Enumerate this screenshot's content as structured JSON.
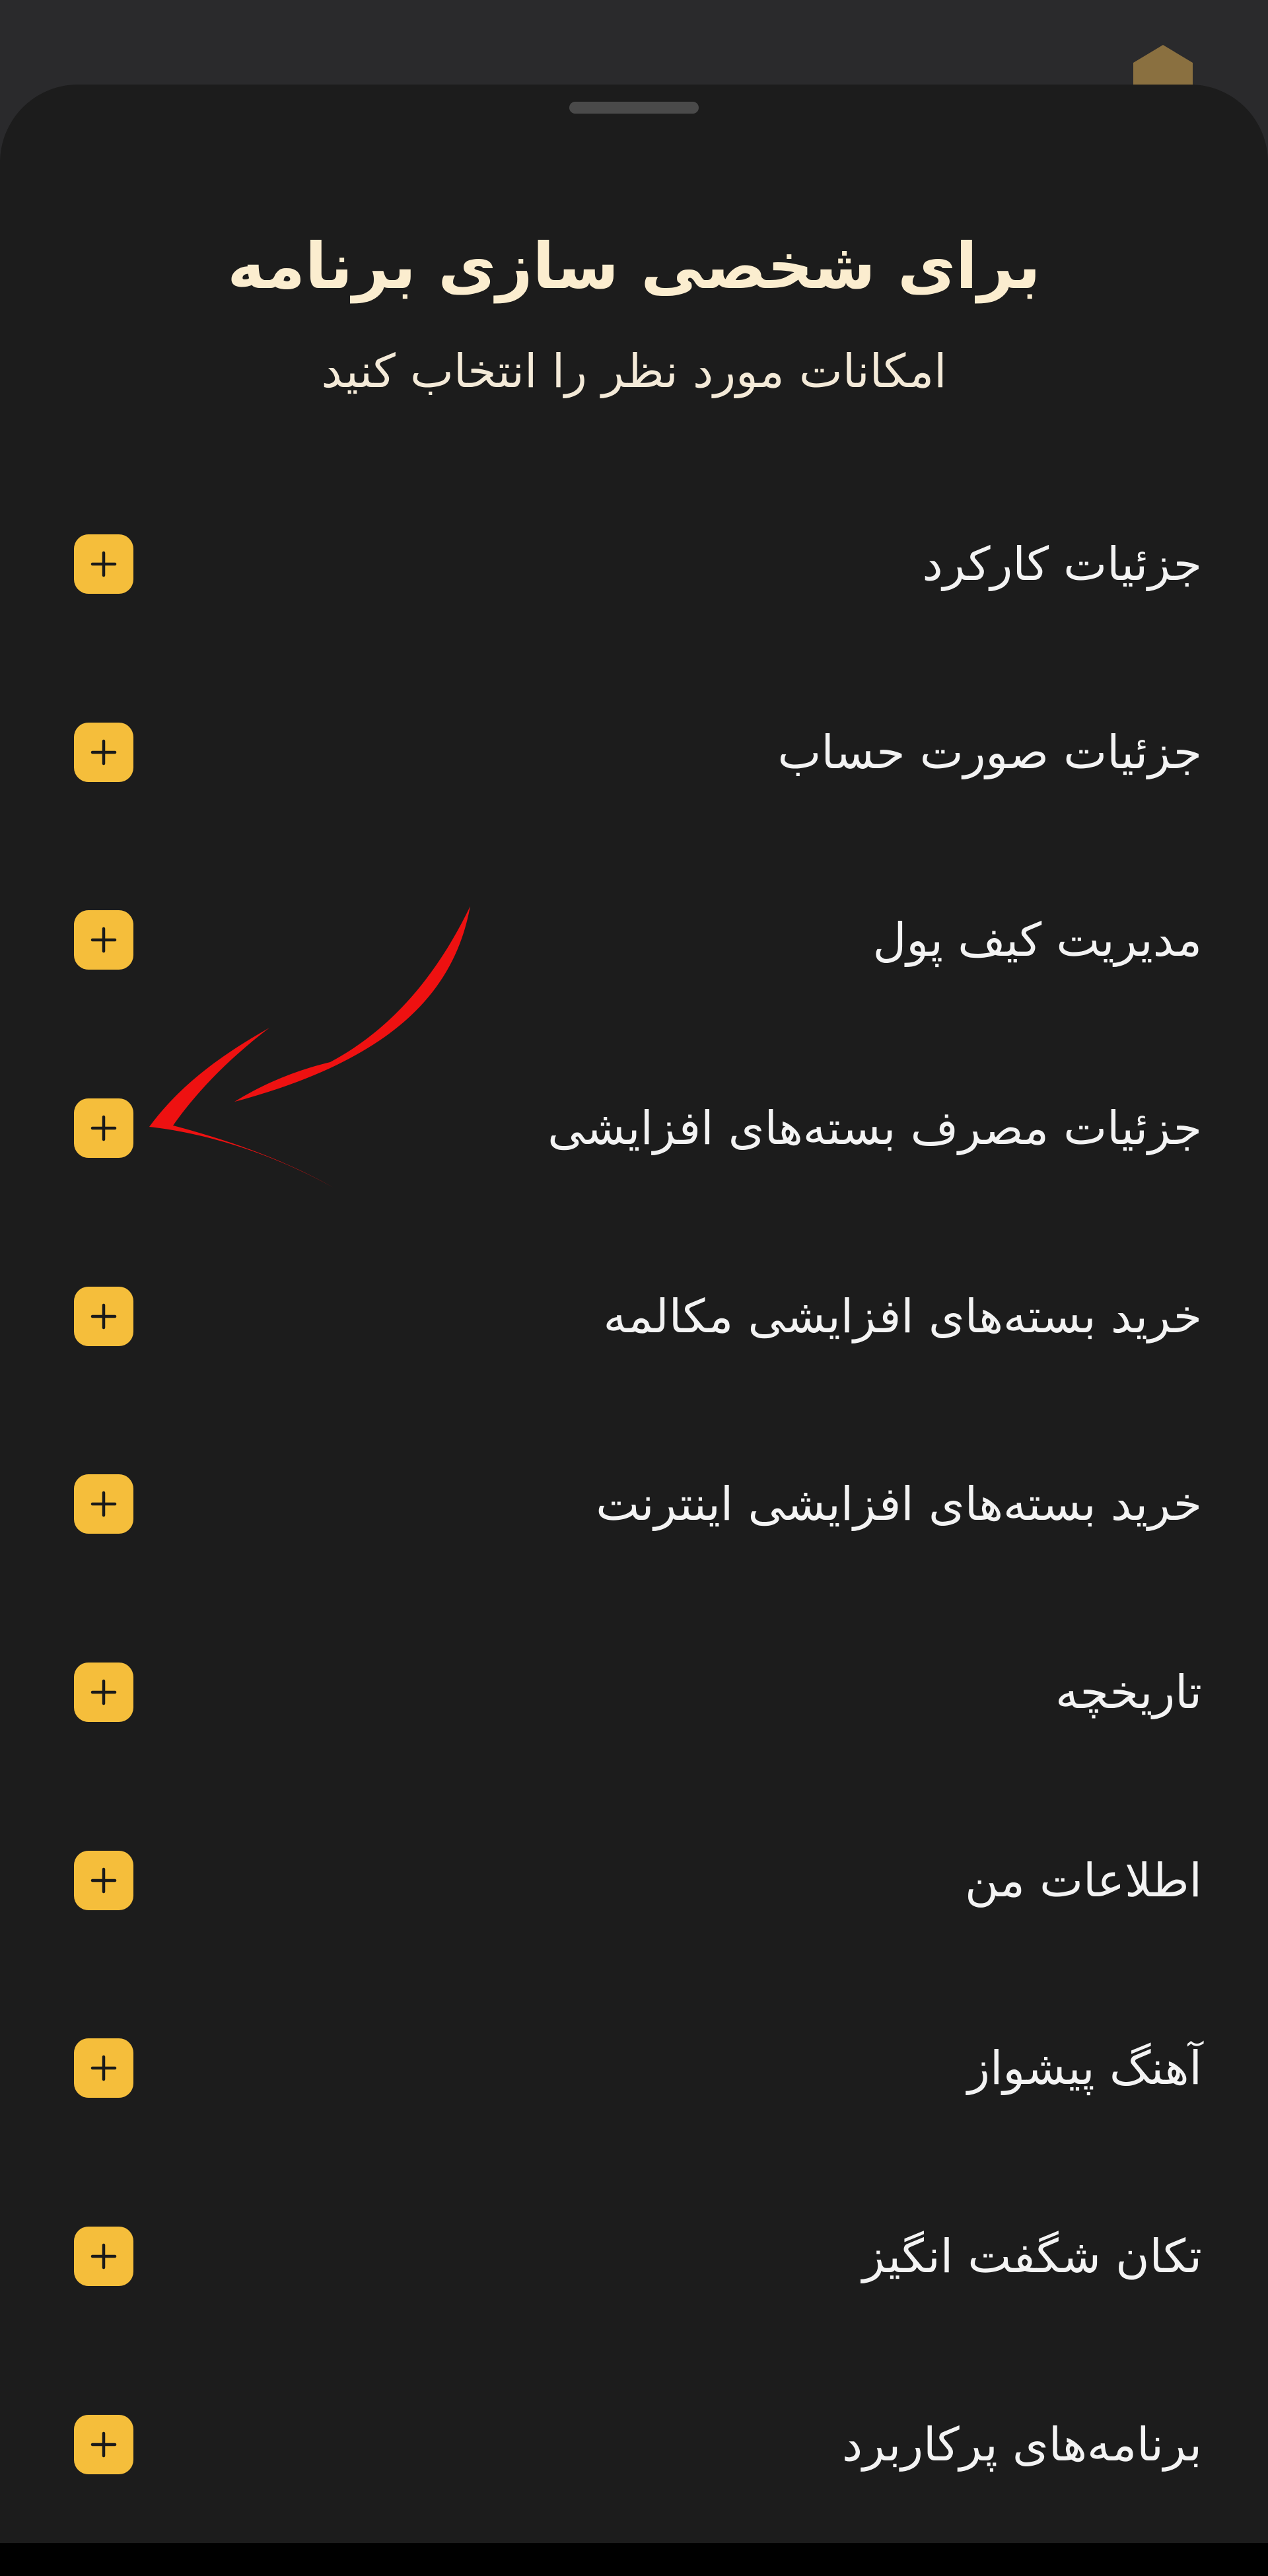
{
  "sheet": {
    "title": "برای شخصی سازی برنامه",
    "subtitle": "امکانات مورد نظر را انتخاب کنید"
  },
  "features": [
    {
      "label": "جزئیات کارکرد"
    },
    {
      "label": "جزئیات صورت حساب"
    },
    {
      "label": "مدیریت کیف پول"
    },
    {
      "label": "جزئیات مصرف بسته‌های افزایشی"
    },
    {
      "label": "خرید بسته‌های افزایشی مکالمه"
    },
    {
      "label": "خرید بسته‌های افزایشی اینترنت"
    },
    {
      "label": "تاریخچه"
    },
    {
      "label": "اطلاعات من"
    },
    {
      "label": "آهنگ پیشواز"
    },
    {
      "label": "تکان شگفت انگیز"
    },
    {
      "label": "برنامه‌های پرکاربرد"
    }
  ],
  "icons": {
    "add": "plus-icon"
  },
  "colors": {
    "sheet_background": "#1c1c1c",
    "accent": "#f5be3b",
    "title_text": "#fbedcf",
    "annotation": "#ee1111"
  }
}
